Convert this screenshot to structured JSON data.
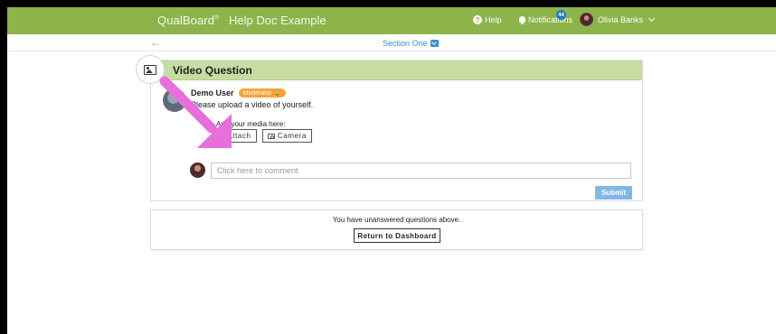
{
  "topnav": {
    "brand": "QualBoard",
    "brand_mark": "®",
    "doc_title": "Help Doc Example",
    "help_label": "Help",
    "notifications_label": "Notifications",
    "notifications_count": "44",
    "user_name": "Olivia Banks"
  },
  "section": {
    "back_icon": "arrow-left-icon",
    "title": "Section One"
  },
  "question": {
    "title": "Video Question",
    "author": "Demo User",
    "badge": "Moderator",
    "prompt": "Please upload a video of yourself.",
    "media_label": "Add your media here:",
    "attach_label": "Attach",
    "camera_label": "Camera",
    "comment_placeholder": "Click here to comment",
    "submit_label": "Submit"
  },
  "notice": {
    "text": "You have unanswered questions above.",
    "button_label": "Return to Dashboard"
  },
  "colors": {
    "nav_green": "#8cb44a",
    "header_green": "#c6dca3",
    "link_blue": "#3a8fd1",
    "badge_orange": "#f7a33a",
    "submit_blue": "#82b7e8",
    "arrow_pink": "#e66fdc"
  }
}
